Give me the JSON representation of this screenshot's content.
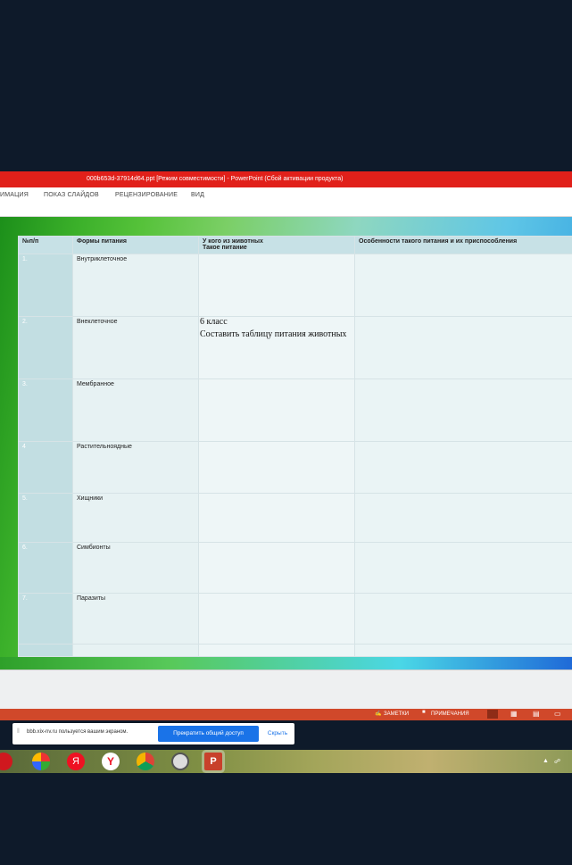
{
  "window": {
    "title": "000b653d-37914d64.ppt [Режим совместимости] - PowerPoint (Сбой активации продукта)"
  },
  "ribbon": {
    "tabs": [
      "ИМАЦИЯ",
      "ПОКАЗ СЛАЙДОВ",
      "РЕЦЕНЗИРОВАНИЕ",
      "ВИД"
    ]
  },
  "slide": {
    "table": {
      "headers": [
        "№п/п",
        "Формы питания",
        "У кого из животных\nТакое питание",
        "Особенности такого питания и их приспособления"
      ],
      "rows": [
        {
          "num": "1.",
          "form": "Внутриклеточное"
        },
        {
          "num": "2.",
          "form": "Внеклеточное"
        },
        {
          "num": "3.",
          "form": "Мембранное"
        },
        {
          "num": "4",
          "form": " Растительноядные"
        },
        {
          "num": "5.",
          "form": "Хищники"
        },
        {
          "num": "6.",
          "form": "Симбионты"
        },
        {
          "num": "7.",
          "form": "Паразиты"
        }
      ]
    },
    "overlay": {
      "line1": "6 класс",
      "line2": "Составить таблицу питания животных"
    }
  },
  "statusbar": {
    "notes": "ЗАМЕТКИ",
    "comments": "ПРИМЕЧАНИЯ"
  },
  "share": {
    "message": "bbb.xix-nv.ru пользуется вашим экраном.",
    "stop_label": "Прекратить общий доступ",
    "hide_label": "Скрыть"
  },
  "taskbar": {
    "icons": [
      "opera-icon",
      "picasa-icon",
      "yandex-icon",
      "yandex-browser-icon",
      "chrome-icon",
      "film-icon",
      "powerpoint-icon"
    ]
  },
  "colors": {
    "titlebar": "#e1201a",
    "statusbar": "#d0482a",
    "share_button": "#1a73e8"
  }
}
